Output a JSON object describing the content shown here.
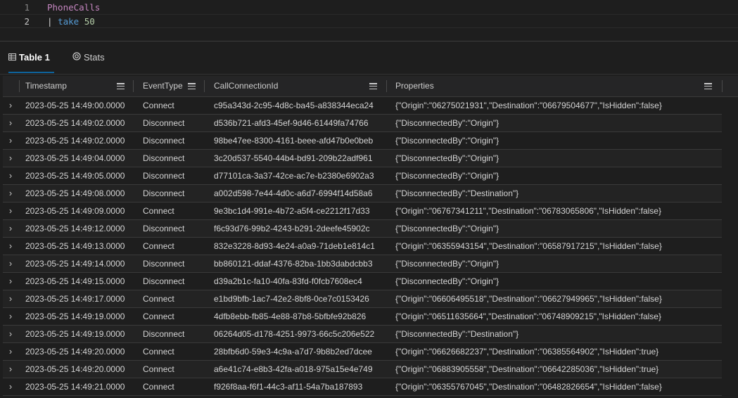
{
  "editor": {
    "lines": [
      {
        "number": "1",
        "table": "PhoneCalls"
      },
      {
        "number": "2",
        "pipe": "|",
        "keyword": "take",
        "count": "50"
      }
    ]
  },
  "tabs": [
    {
      "label": "Table 1",
      "icon": "table-icon",
      "active": true
    },
    {
      "label": "Stats",
      "icon": "stats-icon",
      "active": false
    }
  ],
  "columns": [
    "Timestamp",
    "EventType",
    "CallConnectionId",
    "Properties"
  ],
  "rows": [
    {
      "timestamp": "2023-05-25 14:49:00.0000",
      "event": "Connect",
      "id": "c95a343d-2c95-4d8c-ba45-a838344eca24",
      "props": "{\"Origin\":\"06275021931\",\"Destination\":\"06679504677\",\"IsHidden\":false}"
    },
    {
      "timestamp": "2023-05-25 14:49:02.0000",
      "event": "Disconnect",
      "id": "d536b721-afd3-45ef-9d46-61449fa74766",
      "props": "{\"DisconnectedBy\":\"Origin\"}"
    },
    {
      "timestamp": "2023-05-25 14:49:02.0000",
      "event": "Disconnect",
      "id": "98be47ee-8300-4161-beee-afd47b0e0beb",
      "props": "{\"DisconnectedBy\":\"Origin\"}"
    },
    {
      "timestamp": "2023-05-25 14:49:04.0000",
      "event": "Disconnect",
      "id": "3c20d537-5540-44b4-bd91-209b22adf961",
      "props": "{\"DisconnectedBy\":\"Origin\"}"
    },
    {
      "timestamp": "2023-05-25 14:49:05.0000",
      "event": "Disconnect",
      "id": "d77101ca-3a37-42ce-ac7e-b2380e6902a3",
      "props": "{\"DisconnectedBy\":\"Origin\"}"
    },
    {
      "timestamp": "2023-05-25 14:49:08.0000",
      "event": "Disconnect",
      "id": "a002d598-7e44-4d0c-a6d7-6994f14d58a6",
      "props": "{\"DisconnectedBy\":\"Destination\"}"
    },
    {
      "timestamp": "2023-05-25 14:49:09.0000",
      "event": "Connect",
      "id": "9e3bc1d4-991e-4b72-a5f4-ce2212f17d33",
      "props": "{\"Origin\":\"06767341211\",\"Destination\":\"06783065806\",\"IsHidden\":false}"
    },
    {
      "timestamp": "2023-05-25 14:49:12.0000",
      "event": "Disconnect",
      "id": "f6c93d76-99b2-4243-b291-2deefe45902c",
      "props": "{\"DisconnectedBy\":\"Origin\"}"
    },
    {
      "timestamp": "2023-05-25 14:49:13.0000",
      "event": "Connect",
      "id": "832e3228-8d93-4e24-a0a9-71deb1e814c1",
      "props": "{\"Origin\":\"06355943154\",\"Destination\":\"06587917215\",\"IsHidden\":false}"
    },
    {
      "timestamp": "2023-05-25 14:49:14.0000",
      "event": "Disconnect",
      "id": "bb860121-ddaf-4376-82ba-1bb3dabdcbb3",
      "props": "{\"DisconnectedBy\":\"Origin\"}"
    },
    {
      "timestamp": "2023-05-25 14:49:15.0000",
      "event": "Disconnect",
      "id": "d39a2b1c-fa10-40fa-83fd-f0fcb7608ec4",
      "props": "{\"DisconnectedBy\":\"Origin\"}"
    },
    {
      "timestamp": "2023-05-25 14:49:17.0000",
      "event": "Connect",
      "id": "e1bd9bfb-1ac7-42e2-8bf8-0ce7c0153426",
      "props": "{\"Origin\":\"06606495518\",\"Destination\":\"06627949965\",\"IsHidden\":false}"
    },
    {
      "timestamp": "2023-05-25 14:49:19.0000",
      "event": "Connect",
      "id": "4dfb8ebb-fb85-4e88-87b8-5bfbfe92b826",
      "props": "{\"Origin\":\"06511635664\",\"Destination\":\"06748909215\",\"IsHidden\":false}"
    },
    {
      "timestamp": "2023-05-25 14:49:19.0000",
      "event": "Disconnect",
      "id": "06264d05-d178-4251-9973-66c5c206e522",
      "props": "{\"DisconnectedBy\":\"Destination\"}"
    },
    {
      "timestamp": "2023-05-25 14:49:20.0000",
      "event": "Connect",
      "id": "28bfb6d0-59e3-4c9a-a7d7-9b8b2ed7dcee",
      "props": "{\"Origin\":\"06626682237\",\"Destination\":\"06385564902\",\"IsHidden\":true}"
    },
    {
      "timestamp": "2023-05-25 14:49:20.0000",
      "event": "Connect",
      "id": "a6e41c74-e8b3-42fa-a018-975a15e4e749",
      "props": "{\"Origin\":\"06883905558\",\"Destination\":\"06642285036\",\"IsHidden\":true}"
    },
    {
      "timestamp": "2023-05-25 14:49:21.0000",
      "event": "Connect",
      "id": "f926f8aa-f6f1-44c3-af11-54a7ba187893",
      "props": "{\"Origin\":\"06355767045\",\"Destination\":\"06482826654\",\"IsHidden\":false}"
    }
  ],
  "icons": {
    "expand": "chevron-right-icon",
    "column_menu": "menu-icon"
  },
  "colors": {
    "background": "#1e1e1e",
    "header": "#252526",
    "accent": "#0e639c",
    "table_token": "#c586c0",
    "keyword_token": "#569cd6",
    "number_token": "#b5cea8"
  }
}
